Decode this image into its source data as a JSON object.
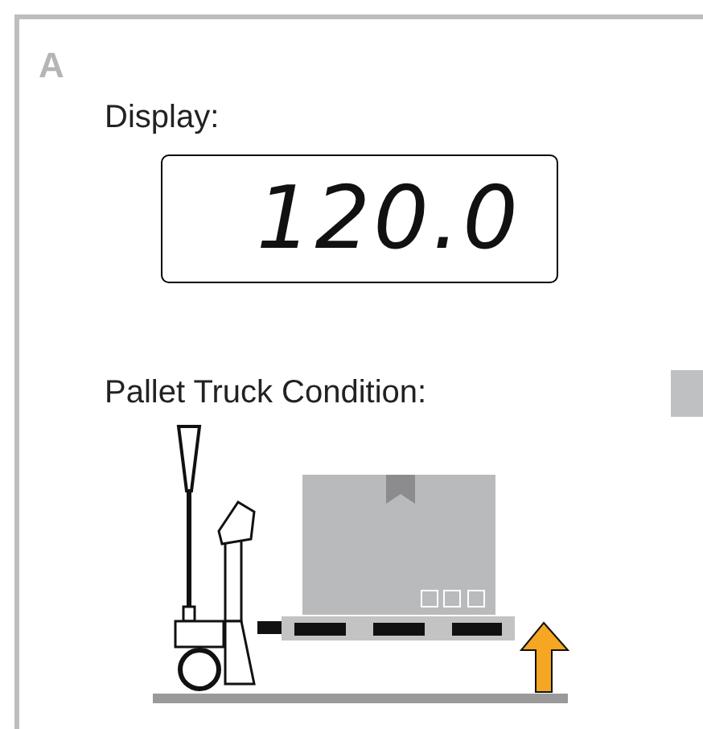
{
  "panel": {
    "label": "A"
  },
  "display": {
    "label": "Display:",
    "value": "120.0"
  },
  "condition": {
    "label": "Pallet Truck Condition:"
  }
}
